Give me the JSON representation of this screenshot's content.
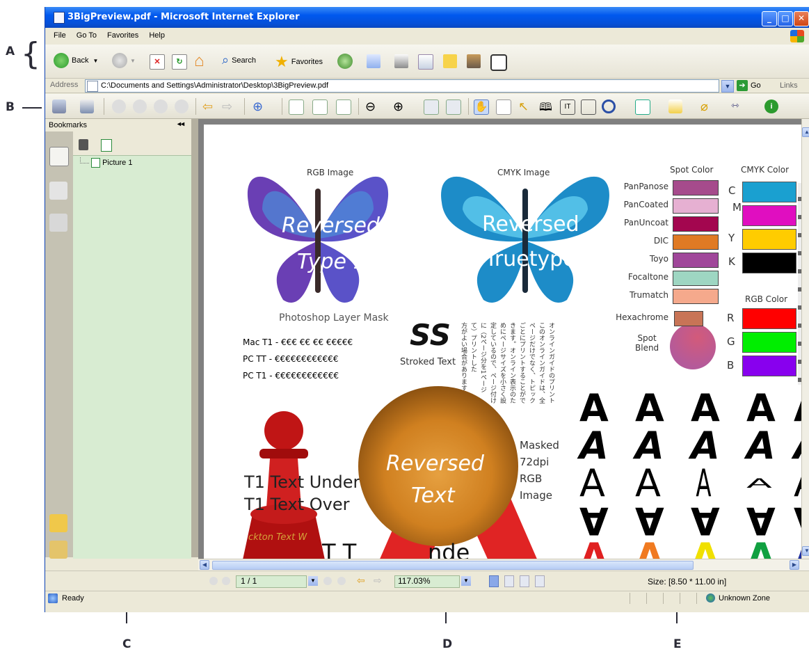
{
  "callouts": {
    "a": "A",
    "b": "B",
    "c": "C",
    "d": "D",
    "e": "E"
  },
  "window": {
    "title": "3BigPreview.pdf - Microsoft Internet Explorer"
  },
  "menu": [
    "File",
    "Go To",
    "Favorites",
    "Help"
  ],
  "toolbar": {
    "back": "Back",
    "search": "Search",
    "favorites": "Favorites"
  },
  "address": {
    "label": "Address",
    "value": "C:\\Documents and Settings\\Administrator\\Desktop\\3BigPreview.pdf",
    "go": "Go",
    "links": "Links"
  },
  "bookmarks": {
    "title": "Bookmarks",
    "collapse": "◂◂",
    "item": "Picture 1"
  },
  "pdfstatus": {
    "page": "1 / 1",
    "zoom": "117.03%",
    "size": "Size: [8.50 * 11.00 in]"
  },
  "iestatus": {
    "ready": "Ready",
    "zone": "Unknown Zone"
  },
  "doc": {
    "rgb_image": "RGB Image",
    "cmyk_image": "CMYK Image",
    "reversed1": "Reversed",
    "type1": "Type 1",
    "reversed2": "Reversed",
    "truetype": "Truetype",
    "layer_mask": "Photoshop Layer Mask",
    "mac_t1": "Mac T1 - €€€ €€ €€ €€€€€",
    "pc_tt": "PC TT - €€€€€€€€€€€€",
    "pc_t1": "PC T1 - €€€€€€€€€€€€",
    "ss": "SS",
    "stroked": "Stroked Text",
    "spot_color": "Spot Color",
    "cmyk_color": "CMYK Color",
    "rgb_color": "RGB Color",
    "spot": [
      "PanPanose",
      "PanCoated",
      "PanUncoat",
      "DIC",
      "Toyo",
      "Focaltone",
      "Trumatch",
      "Hexachrome"
    ],
    "cmyk_letters": [
      "C",
      "M",
      "Y",
      "K"
    ],
    "rgb_letters": [
      "R",
      "G",
      "B"
    ],
    "spot_blend": "Spot\nBlend",
    "jp": [
      "オンラインガイドのプリント",
      "このオンラインガイドは、全",
      "ページだけでなく、トピック",
      "ごとにプリントすることがで",
      "きます。オンライン表示のた",
      "めにページサイズを小さく設",
      "定しているので、ページ付け",
      "に（2ページ分を1ページ",
      "て）プリントした",
      "方がよい場合があります"
    ],
    "t1_under": "T1 Text Under",
    "t1_over": "T1 Text Over",
    "reversed3": "Reversed",
    "text3": "Text",
    "masked": [
      "Masked",
      "72dpi",
      "RGB",
      "Image"
    ],
    "pawn_text": "ckton Text W",
    "bottom_t": "T T",
    "bottom_nde": "nde",
    "a_letter": "A"
  },
  "colors": {
    "spot": [
      "#a64b8c",
      "#e6b0d2",
      "#a3064f",
      "#e07a24",
      "#a0479a",
      "#9ed6c2",
      "#f5a98c",
      "#c87456"
    ],
    "cmyk": [
      "#1aa0d0",
      "#e00ec0",
      "#ffcc00",
      "#000000"
    ],
    "rgb": [
      "#ff0000",
      "#00ee00",
      "#8800ee"
    ]
  }
}
